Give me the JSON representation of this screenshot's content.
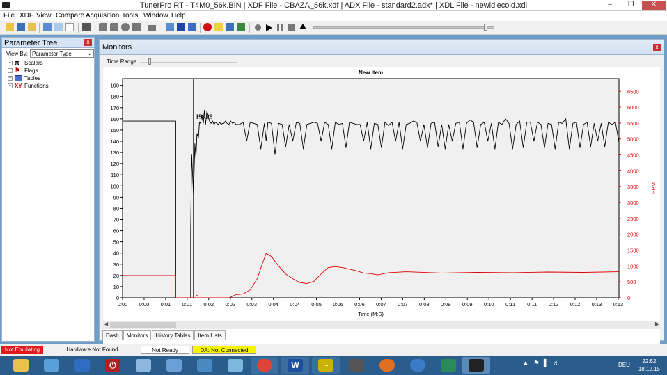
{
  "window": {
    "title": "TunerPro RT - T4M0_56k.BIN | XDF File - CBAZA_56k.xdf | ADX File - standard2.adx* | XDL File - newidlecold.xdl",
    "minimize": "–",
    "maximize": "❐",
    "close": "✕"
  },
  "menu": [
    "File",
    "XDF",
    "View",
    "Compare",
    "Acquisition",
    "Tools",
    "Window",
    "Help"
  ],
  "parameter_tree": {
    "title": "Parameter Tree",
    "close": "x",
    "view_by_label": "View By:",
    "view_by_value": "Parameter Type",
    "nodes": [
      {
        "label": "Scalars",
        "icon": "pi-icon"
      },
      {
        "label": "Flags",
        "icon": "flag-icon"
      },
      {
        "label": "Tables",
        "icon": "table-icon"
      },
      {
        "label": "Functions",
        "icon": "function-icon"
      }
    ]
  },
  "monitors": {
    "title": "Monitors",
    "close": "x",
    "time_range_label": "Time Range",
    "tabs": [
      "Dash",
      "Monitors",
      "History Tables",
      "Item Lists"
    ],
    "active_tab": "Monitors"
  },
  "chart_data": {
    "type": "line",
    "title": "New Item",
    "xlabel": "Time (M:S)",
    "ylabel_right": "RPM",
    "ylim": [
      0,
      196
    ],
    "y2lim": [
      0,
      6900
    ],
    "yticks": [
      0,
      10,
      20,
      30,
      40,
      50,
      60,
      70,
      80,
      90,
      100,
      110,
      120,
      130,
      140,
      150,
      160,
      170,
      180,
      190
    ],
    "y2ticks": [
      0,
      500,
      1000,
      1500,
      2000,
      2500,
      3000,
      3500,
      4000,
      4500,
      5000,
      5500,
      6000,
      6500
    ],
    "xticks": [
      "0:00",
      "0:00",
      "0:01",
      "0:01",
      "0:02",
      "0:02",
      "0:03",
      "0:04",
      "0:04",
      "0:05",
      "0:06",
      "0:06",
      "0:07",
      "0:07",
      "0:08",
      "0:09",
      "0:09",
      "0:10",
      "0:11",
      "0:11",
      "0:12",
      "0:12",
      "0:13",
      "0:13"
    ],
    "cursor_readout": "158.25",
    "cursor_readout2": "0",
    "colors": {
      "series1": "#000000",
      "series2": "#dd0000",
      "right_axis": "#dd0000"
    },
    "series": [
      {
        "axis": "left",
        "color": "#000000",
        "x": [
          0,
          1.5,
          1.5,
          1.92,
          1.92,
          1.95,
          2.0,
          2.04,
          2.07,
          2.1,
          2.14,
          2.17,
          2.2,
          2.23,
          2.28,
          2.31,
          2.34,
          2.38,
          2.42,
          2.46,
          2.5,
          2.54,
          2.58,
          2.62,
          2.66,
          2.7,
          2.74,
          2.78,
          2.82,
          2.86,
          2.9,
          2.95,
          3.0,
          3.05,
          3.1,
          3.15,
          3.2,
          3.3,
          3.4,
          3.5,
          3.6,
          3.7,
          3.8,
          3.9,
          4.0,
          4.05,
          4.1,
          4.2,
          4.3,
          4.4,
          4.5,
          4.6,
          4.7,
          4.8,
          4.9,
          5.0,
          5.1,
          5.2,
          5.3,
          5.4,
          5.5,
          5.6,
          5.7,
          5.8,
          5.9,
          6.0,
          6.1,
          6.2,
          6.3,
          6.4,
          6.5,
          6.6,
          6.7,
          6.8,
          6.9,
          7.0,
          7.1,
          7.2,
          7.3,
          7.4,
          7.5,
          7.6,
          7.7,
          7.8,
          7.9,
          8.0,
          8.1,
          8.2,
          8.3,
          8.4,
          8.5,
          8.6,
          8.7,
          8.8,
          8.9,
          9.0,
          9.1,
          9.2,
          9.3,
          9.4,
          9.5,
          9.6,
          9.7,
          9.8,
          9.9,
          10.0,
          10.1,
          10.2,
          10.3,
          10.4,
          10.5,
          10.6,
          10.7,
          10.8,
          10.9,
          11.0,
          11.1,
          11.2,
          11.3,
          11.4,
          11.5,
          11.6,
          11.7,
          11.8,
          11.9,
          12.0,
          12.1,
          12.2,
          12.3,
          12.4,
          12.5,
          12.6,
          12.7,
          12.8,
          12.9,
          13.0,
          13.1,
          13.2,
          13.3,
          13.4,
          13.5,
          13.6,
          13.7,
          13.8,
          13.9,
          14.0
        ],
        "y": [
          158,
          158,
          0,
          0,
          60,
          128,
          92,
          138,
          125,
          147,
          143,
          157,
          156,
          163,
          156,
          168,
          155,
          167,
          162,
          157,
          156,
          158,
          155,
          157,
          156,
          155,
          157,
          155,
          156,
          156,
          158,
          156,
          155,
          158,
          156,
          157,
          155,
          155,
          157,
          140,
          157,
          156,
          155,
          133,
          156,
          140,
          157,
          156,
          128,
          156,
          155,
          135,
          155,
          140,
          157,
          156,
          133,
          155,
          156,
          157,
          156,
          140,
          157,
          155,
          133,
          157,
          155,
          156,
          134,
          157,
          156,
          155,
          155,
          140,
          157,
          133,
          156,
          155,
          134,
          157,
          154,
          157,
          140,
          157,
          133,
          155,
          156,
          158,
          157,
          140,
          155,
          134,
          156,
          157,
          135,
          155,
          133,
          155,
          140,
          156,
          157,
          133,
          156,
          159,
          157,
          134,
          155,
          157,
          140,
          156,
          133,
          157,
          155,
          160,
          156,
          133,
          155,
          158,
          134,
          157,
          157,
          140,
          157,
          155,
          134,
          156,
          155,
          133,
          157,
          156,
          160,
          133,
          156,
          157,
          134,
          155,
          157,
          135,
          156,
          140,
          156,
          135,
          157,
          155,
          157,
          139
        ]
      },
      {
        "axis": "right",
        "color": "#dd0000",
        "x": [
          0,
          1.5,
          1.5,
          3.0,
          3.2,
          3.4,
          3.6,
          3.8,
          3.95,
          4.05,
          4.2,
          4.4,
          4.6,
          4.8,
          5.0,
          5.2,
          5.4,
          5.6,
          5.8,
          6.0,
          6.2,
          6.4,
          6.6,
          6.8,
          7.0,
          7.2,
          7.5,
          8,
          9,
          10,
          11,
          12,
          13,
          14
        ],
        "y": [
          700,
          700,
          0,
          0,
          100,
          120,
          250,
          600,
          1100,
          1400,
          1300,
          1000,
          750,
          600,
          480,
          450,
          520,
          750,
          950,
          980,
          950,
          900,
          850,
          780,
          760,
          720,
          790,
          820,
          780,
          800,
          790,
          810,
          800,
          820
        ]
      }
    ]
  },
  "status": {
    "emulation": "Not Emulating",
    "hardware": "Hardware Not Found",
    "ready": "Not Ready",
    "da": "DA: Not Connected"
  },
  "taskbar": {
    "lang": "DEU",
    "time": "22:52",
    "date": "18.12.15"
  }
}
